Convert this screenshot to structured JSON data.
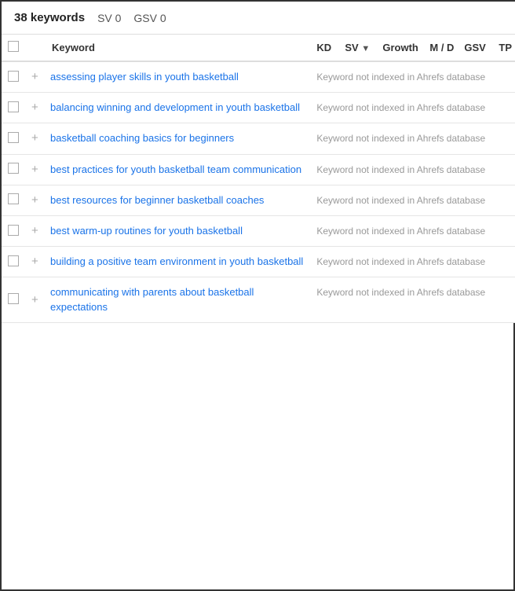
{
  "header": {
    "keywords_count": "38 keywords",
    "sv_label": "SV 0",
    "gsv_label": "GSV 0"
  },
  "table": {
    "columns": [
      {
        "id": "checkbox",
        "label": ""
      },
      {
        "id": "plus",
        "label": ""
      },
      {
        "id": "keyword",
        "label": "Keyword"
      },
      {
        "id": "kd",
        "label": "KD"
      },
      {
        "id": "sv",
        "label": "SV",
        "sort": "▼"
      },
      {
        "id": "growth",
        "label": "Growth"
      },
      {
        "id": "md",
        "label": "M / D"
      },
      {
        "id": "gsv",
        "label": "GSV"
      },
      {
        "id": "tp",
        "label": "TP"
      }
    ],
    "not_indexed_text": "Keyword not indexed in Ahrefs database",
    "rows": [
      {
        "keyword": "assessing player skills in youth basketball"
      },
      {
        "keyword": "balancing winning and development in youth basketball"
      },
      {
        "keyword": "basketball coaching basics for beginners"
      },
      {
        "keyword": "best practices for youth basketball team communication"
      },
      {
        "keyword": "best resources for beginner basketball coaches"
      },
      {
        "keyword": "best warm-up routines for youth basketball"
      },
      {
        "keyword": "building a positive team environment in youth basketball"
      },
      {
        "keyword": "communicating with parents about basketball expectations"
      }
    ]
  }
}
